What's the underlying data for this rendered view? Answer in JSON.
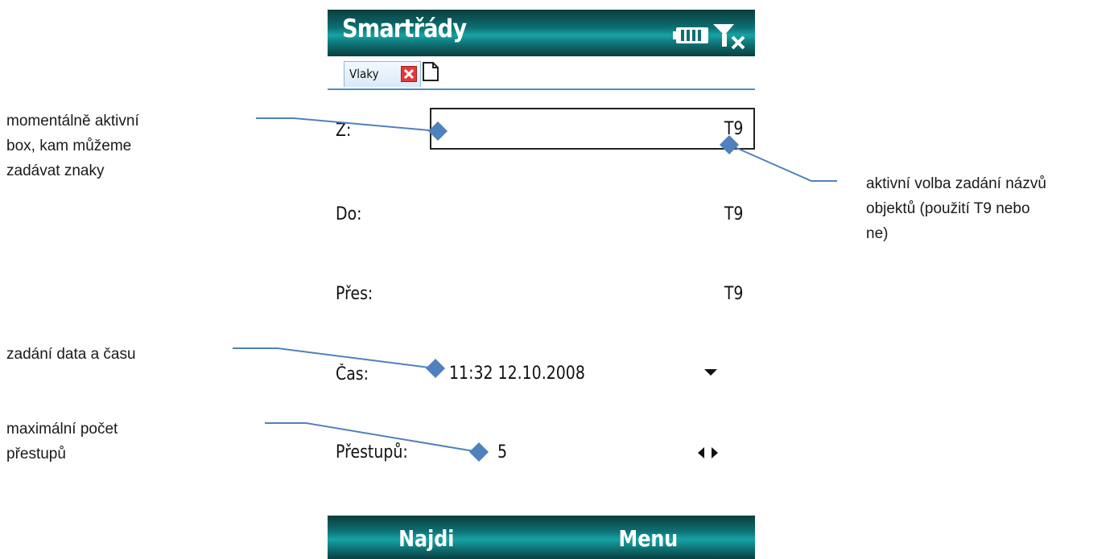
{
  "app": {
    "title": "Smartřády"
  },
  "tabs": [
    {
      "label": "Vlaky"
    }
  ],
  "form": {
    "fields": [
      {
        "label": "Z:",
        "value": "",
        "t9": "T9"
      },
      {
        "label": "Do:",
        "value": "",
        "t9": "T9"
      },
      {
        "label": "Přes:",
        "value": "",
        "t9": "T9"
      },
      {
        "label": "Čas:",
        "value": "11:32  12.10.2008"
      },
      {
        "label": "Přestupů:",
        "value": "5"
      }
    ]
  },
  "softkeys": {
    "left": "Najdi",
    "right": "Menu"
  },
  "annotations": {
    "active_box": [
      "momentálně aktivní",
      "box, kam můžeme",
      "zadávat znaky"
    ],
    "t9_option": [
      "aktivní volba zadání názvů",
      "objektů (použití T9 nebo",
      "ne)"
    ],
    "date_time": [
      "zadání data a času"
    ],
    "max_transfers": [
      "maximální počet",
      "přestupů"
    ]
  },
  "colors": {
    "accent": "#0e6e70",
    "callout": "#4f81bd"
  }
}
